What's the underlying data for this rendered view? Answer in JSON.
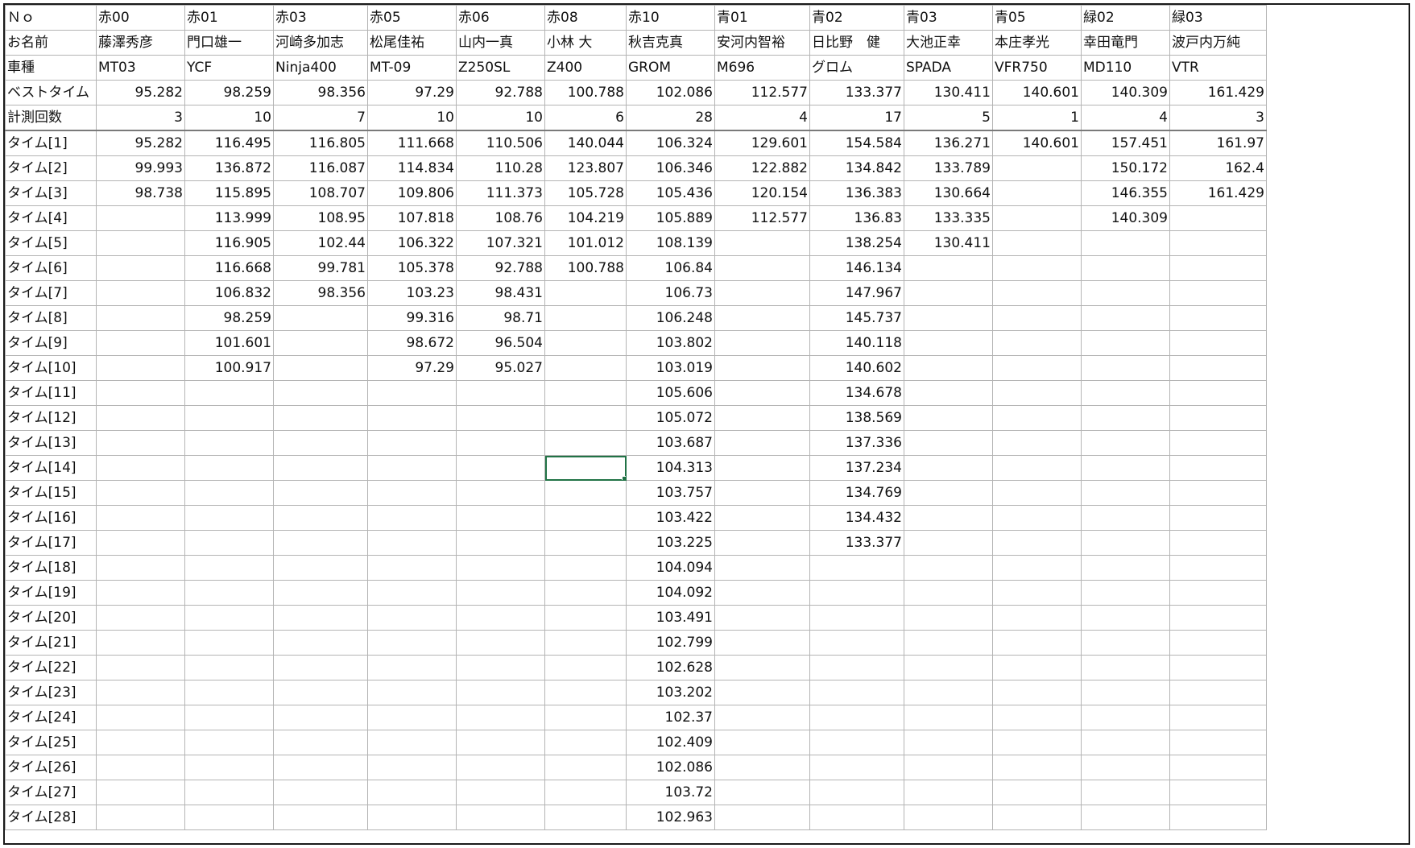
{
  "sheet": {
    "labels": {
      "no": "Ｎｏ",
      "name": "お名前",
      "model": "車種",
      "best": "ベストタイム",
      "count": "計測回数"
    },
    "riders": [
      {
        "no": "赤00",
        "name": "藤澤秀彦",
        "model": "MT03",
        "best": "95.282",
        "count": "3",
        "times": [
          "95.282",
          "99.993",
          "98.738"
        ]
      },
      {
        "no": "赤01",
        "name": "門口雄一",
        "model": "YCF",
        "best": "98.259",
        "count": "10",
        "times": [
          "116.495",
          "136.872",
          "115.895",
          "113.999",
          "116.905",
          "116.668",
          "106.832",
          "98.259",
          "101.601",
          "100.917"
        ]
      },
      {
        "no": "赤03",
        "name": "河崎多加志",
        "model": "Ninja400",
        "best": "98.356",
        "count": "7",
        "times": [
          "116.805",
          "116.087",
          "108.707",
          "108.95",
          "102.44",
          "99.781",
          "98.356"
        ]
      },
      {
        "no": "赤05",
        "name": "松尾佳祐",
        "model": "MT-09",
        "best": "97.29",
        "count": "10",
        "times": [
          "111.668",
          "114.834",
          "109.806",
          "107.818",
          "106.322",
          "105.378",
          "103.23",
          "99.316",
          "98.672",
          "97.29"
        ]
      },
      {
        "no": "赤06",
        "name": "山内一真",
        "model": "Z250SL",
        "best": "92.788",
        "count": "10",
        "times": [
          "110.506",
          "110.28",
          "111.373",
          "108.76",
          "107.321",
          "92.788",
          "98.431",
          "98.71",
          "96.504",
          "95.027"
        ]
      },
      {
        "no": "赤08",
        "name": "小林 大",
        "model": "Z400",
        "best": "100.788",
        "count": "6",
        "times": [
          "140.044",
          "123.807",
          "105.728",
          "104.219",
          "101.012",
          "100.788"
        ]
      },
      {
        "no": "赤10",
        "name": "秋吉克真",
        "model": "GROM",
        "best": "102.086",
        "count": "28",
        "times": [
          "106.324",
          "106.346",
          "105.436",
          "105.889",
          "108.139",
          "106.84",
          "106.73",
          "106.248",
          "103.802",
          "103.019",
          "105.606",
          "105.072",
          "103.687",
          "104.313",
          "103.757",
          "103.422",
          "103.225",
          "104.094",
          "104.092",
          "103.491",
          "102.799",
          "102.628",
          "103.202",
          "102.37",
          "102.409",
          "102.086",
          "103.72",
          "102.963"
        ]
      },
      {
        "no": "青01",
        "name": "安河内智裕",
        "model": "M696",
        "best": "112.577",
        "count": "4",
        "times": [
          "129.601",
          "122.882",
          "120.154",
          "112.577"
        ]
      },
      {
        "no": "青02",
        "name": "日比野　健",
        "model": "グロム",
        "best": "133.377",
        "count": "17",
        "times": [
          "154.584",
          "134.842",
          "136.383",
          "136.83",
          "138.254",
          "146.134",
          "147.967",
          "145.737",
          "140.118",
          "140.602",
          "134.678",
          "138.569",
          "137.336",
          "137.234",
          "134.769",
          "134.432",
          "133.377"
        ]
      },
      {
        "no": "青03",
        "name": "大池正幸",
        "model": "SPADA",
        "best": "130.411",
        "count": "5",
        "times": [
          "136.271",
          "133.789",
          "130.664",
          "133.335",
          "130.411"
        ]
      },
      {
        "no": "青05",
        "name": "本庄孝光",
        "model": "VFR750",
        "best": "140.601",
        "count": "1",
        "times": [
          "140.601"
        ]
      },
      {
        "no": "緑02",
        "name": "幸田竜門",
        "model": "MD110",
        "best": "140.309",
        "count": "4",
        "times": [
          "157.451",
          "150.172",
          "146.355",
          "140.309"
        ]
      },
      {
        "no": "緑03",
        "name": "波戸内万純",
        "model": "VTR",
        "best": "161.429",
        "count": "3",
        "times": [
          "161.97",
          "162.4",
          "161.429"
        ]
      }
    ],
    "time_labels": [
      "タイム[1]",
      "タイム[2]",
      "タイム[3]",
      "タイム[4]",
      "タイム[5]",
      "タイム[6]",
      "タイム[7]",
      "タイム[8]",
      "タイム[9]",
      "タイム[10]",
      "タイム[11]",
      "タイム[12]",
      "タイム[13]",
      "タイム[14]",
      "タイム[15]",
      "タイム[16]",
      "タイム[17]",
      "タイム[18]",
      "タイム[19]",
      "タイム[20]",
      "タイム[21]",
      "タイム[22]",
      "タイム[23]",
      "タイム[24]",
      "タイム[25]",
      "タイム[26]",
      "タイム[27]",
      "タイム[28]"
    ]
  }
}
